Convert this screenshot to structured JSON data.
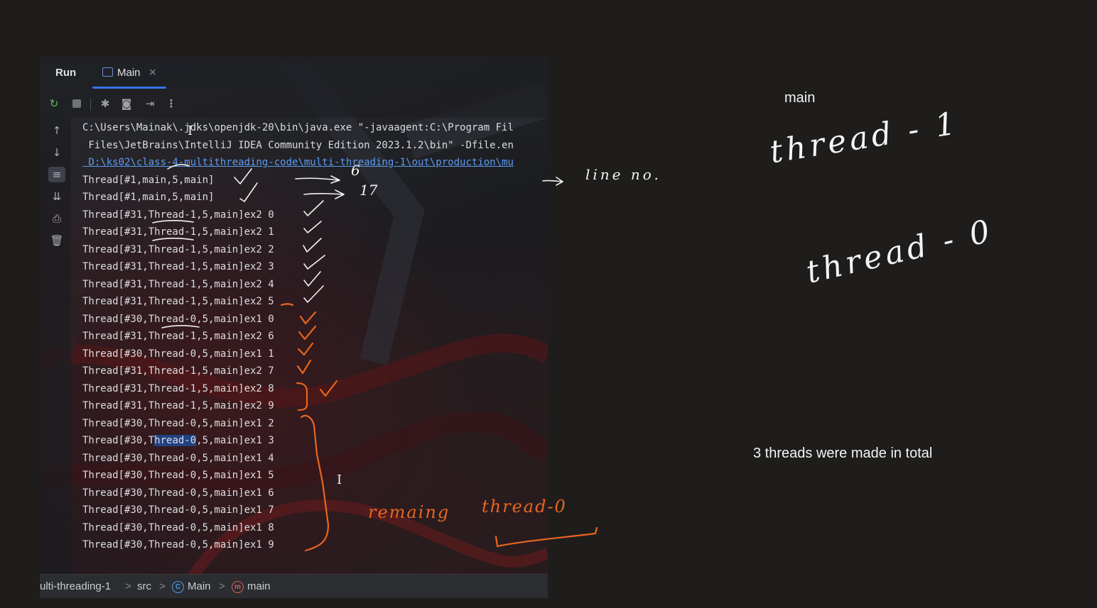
{
  "run_panel": {
    "tabs": {
      "run_label": "Run",
      "main_label": "Main",
      "close_glyph": "×"
    },
    "toolbar_icons": [
      "rerun-icon",
      "stop-icon",
      "debug-icon",
      "screenshot-icon",
      "exit-icon",
      "more-icon"
    ],
    "gutter_icons": [
      "arrow-up-icon",
      "arrow-down-icon",
      "soft-wrap-icon",
      "scroll-to-end-icon",
      "print-icon",
      "trash-icon"
    ],
    "console_lines": [
      "C:\\Users\\Mainak\\.jdks\\openjdk-20\\bin\\java.exe \"-javaagent:C:\\Program Fil",
      " Files\\JetBrains\\IntelliJ IDEA Community Edition 2023.1.2\\bin\" -Dfile.en",
      " D:\\ks02\\class-4-multithreading-code\\multi-threading-1\\out\\production\\mu",
      "Thread[#1,main,5,main]",
      "Thread[#1,main,5,main]",
      "Thread[#31,Thread-1,5,main]ex2 0",
      "Thread[#31,Thread-1,5,main]ex2 1",
      "Thread[#31,Thread-1,5,main]ex2 2",
      "Thread[#31,Thread-1,5,main]ex2 3",
      "Thread[#31,Thread-1,5,main]ex2 4",
      "Thread[#31,Thread-1,5,main]ex2 5",
      "Thread[#30,Thread-0,5,main]ex1 0",
      "Thread[#31,Thread-1,5,main]ex2 6",
      "Thread[#30,Thread-0,5,main]ex1 1",
      "Thread[#31,Thread-1,5,main]ex2 7",
      "Thread[#31,Thread-1,5,main]ex2 8",
      "Thread[#31,Thread-1,5,main]ex2 9",
      "Thread[#30,Thread-0,5,main]ex1 2",
      "Thread[#30,Thread-0,5,main]ex1 3",
      "Thread[#30,Thread-0,5,main]ex1 4",
      "Thread[#30,Thread-0,5,main]ex1 5",
      "Thread[#30,Thread-0,5,main]ex1 6",
      "Thread[#30,Thread-0,5,main]ex1 7",
      "Thread[#30,Thread-0,5,main]ex1 8",
      "Thread[#30,Thread-0,5,main]ex1 9"
    ],
    "selected_line": {
      "before": "Thread[#30,T",
      "selected": "hread-0",
      "after": ",5,main]ex1 3"
    },
    "breadcrumb": {
      "project": "ulti-threading-1",
      "src": "src",
      "class": "Main",
      "method": "main",
      "class_icon_letter": "C",
      "method_icon_letter": "m",
      "separator": ">"
    }
  },
  "notes": {
    "main_label": "main",
    "thread_1": "thread - 1",
    "thread_0": "thread - 0",
    "summary": "3 threads were made in total"
  },
  "handwritten_annotations": {
    "line_no": "line no.",
    "six": "6",
    "seventeen": "17",
    "remaining": "remaing",
    "remaining_thread": "thread-0"
  },
  "colors": {
    "ink_white": "#f3f3f3",
    "ink_orange": "#e8651f",
    "selection": "#214283",
    "link": "#5b9bf0",
    "accent_tab": "#3574f0"
  }
}
